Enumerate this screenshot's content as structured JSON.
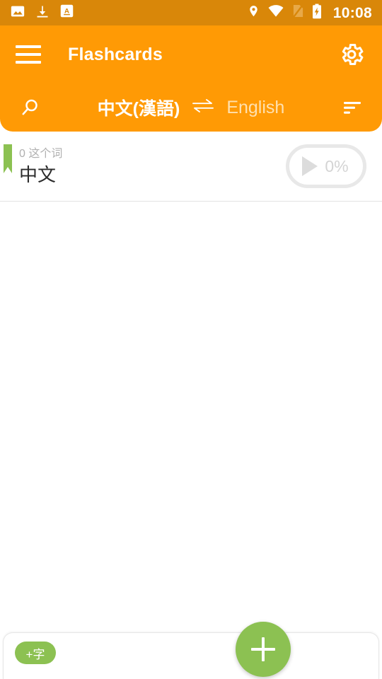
{
  "theme": {
    "status_bar_color": "#d98709",
    "toolbar_color": "#ff9a05",
    "accent_green": "#8cc152",
    "title_text_color": "#ffffff",
    "muted_text_color": "#b0b0b0"
  },
  "status_bar": {
    "icons_left": [
      "image-icon",
      "download-icon",
      "translate-a-icon"
    ],
    "icons_right": [
      "location-icon",
      "wifi-icon",
      "no-sim-icon",
      "battery-charging-icon"
    ],
    "time": "10:08"
  },
  "app_bar": {
    "menu_icon": "hamburger-menu-icon",
    "title": "Flashcards",
    "settings_icon": "gear-icon"
  },
  "language_bar": {
    "search_icon": "search-icon",
    "source_language": "中文(漢語)",
    "swap_icon": "swap-horizontal-icon",
    "target_language": "English",
    "sort_icon": "sort-icon"
  },
  "list": {
    "items": [
      {
        "bookmark_icon": "bookmark-ribbon-icon",
        "subtitle": "0 这个词",
        "title": "中文",
        "play_icon": "play-icon",
        "progress": "0%"
      }
    ]
  },
  "bottom_bar": {
    "tag_label": "+字",
    "fab_icon": "plus-icon",
    "fab_label": "+"
  }
}
